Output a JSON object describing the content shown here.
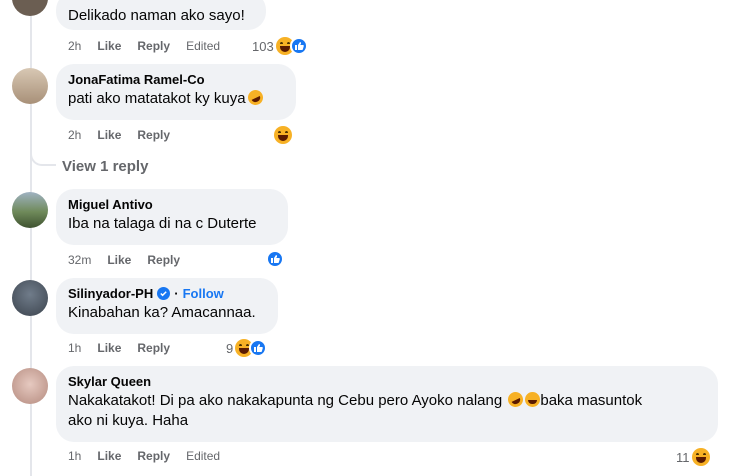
{
  "comments": [
    {
      "name": "",
      "text": "Delikado naman ako sayo!",
      "time": "2h",
      "like": "Like",
      "reply": "Reply",
      "edited": "Edited",
      "reaction_count": "103"
    },
    {
      "name": "JonaFatima Ramel-Co",
      "text": "pati ako matatakot ky kuya",
      "time": "2h",
      "like": "Like",
      "reply": "Reply"
    },
    {
      "name": "Miguel Antivo",
      "text": "Iba na talaga di na c Duterte",
      "time": "32m",
      "like": "Like",
      "reply": "Reply"
    },
    {
      "name": "Silinyador-PH",
      "follow": "Follow",
      "separator": "·",
      "text": "Kinabahan ka? Amacannaa.",
      "time": "1h",
      "like": "Like",
      "reply": "Reply",
      "reaction_count": "9"
    },
    {
      "name": "Skylar Queen",
      "text_line1": "Nakakatakot! Di pa ako nakakapunta ng Cebu pero Ayoko nalang",
      "text_line1_tail": "baka masuntok",
      "text_line2": "ako ni kuya. Haha",
      "time": "1h",
      "like": "Like",
      "reply": "Reply",
      "edited": "Edited",
      "reaction_count": "11"
    }
  ],
  "view_reply": "View 1 reply",
  "colors": {
    "bubble": "#f0f2f5",
    "meta": "#65676b",
    "accent": "#1877f2",
    "haha": "#f7b125"
  },
  "icons": [
    "haha-reaction-icon",
    "like-reaction-icon",
    "verified-badge-icon",
    "laughing-emoji-icon"
  ]
}
